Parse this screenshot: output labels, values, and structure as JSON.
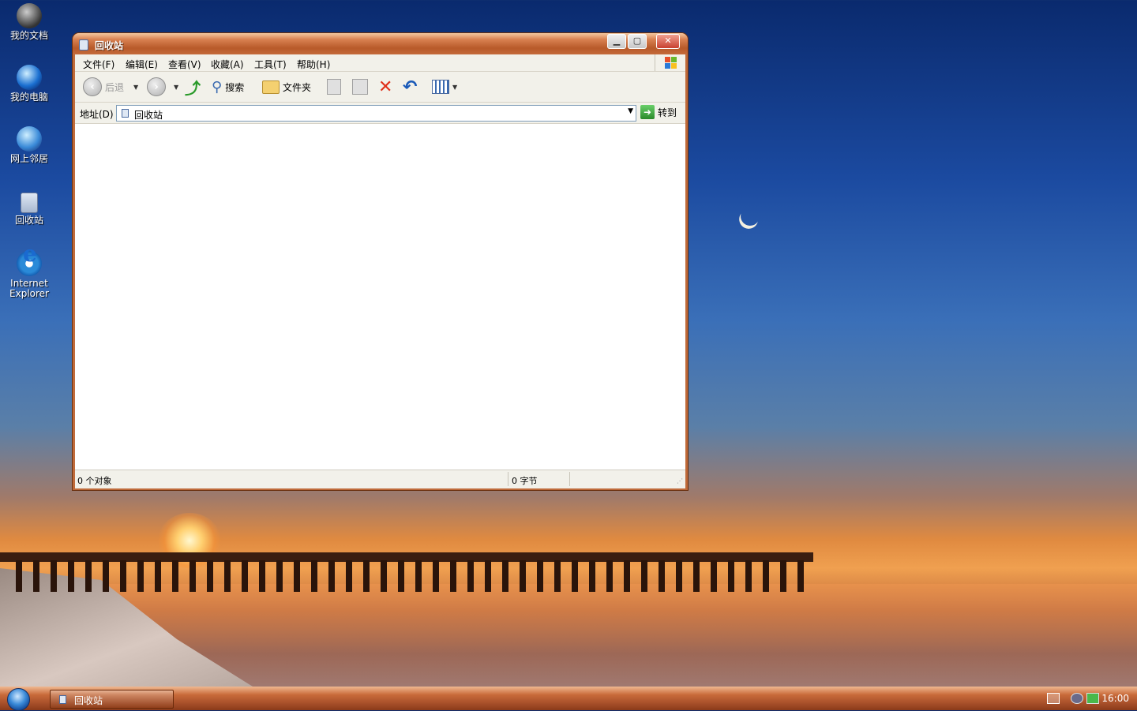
{
  "desktop": {
    "icons": [
      {
        "label": "我的文档"
      },
      {
        "label": "我的电脑"
      },
      {
        "label": "网上邻居"
      },
      {
        "label": "回收站"
      },
      {
        "label": "Internet Explorer"
      }
    ]
  },
  "window": {
    "title": "回收站",
    "menu": [
      "文件(F)",
      "编辑(E)",
      "查看(V)",
      "收藏(A)",
      "工具(T)",
      "帮助(H)"
    ],
    "toolbar": {
      "back_label": "后退",
      "search_label": "搜索",
      "folders_label": "文件夹"
    },
    "address": {
      "label": "地址(D)",
      "value": "回收站",
      "go_label": "转到"
    },
    "status": {
      "objects": "0 个对象",
      "size": "0 字节"
    }
  },
  "taskbar": {
    "active_task": "回收站",
    "clock": "16:00"
  },
  "colors": {
    "titlebar": "#c46a3a",
    "taskbar": "#a8502a",
    "close_button": "#c84030"
  }
}
